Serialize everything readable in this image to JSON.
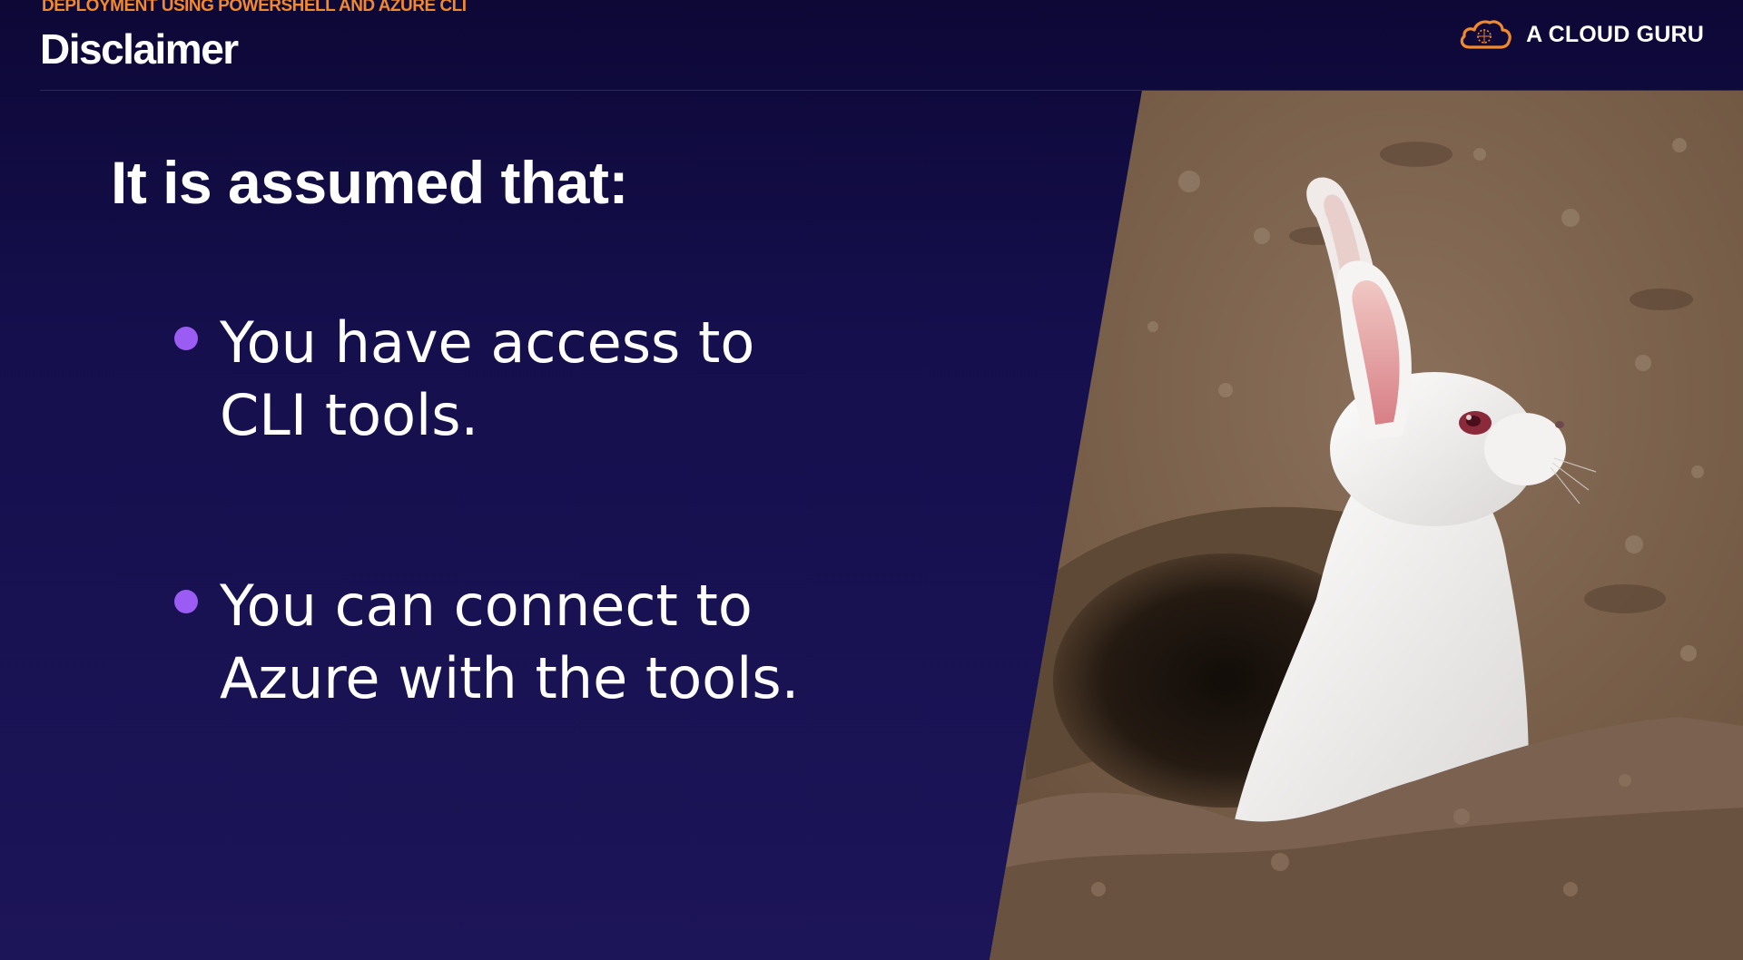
{
  "header": {
    "course": "DEPLOYMENT USING POWERSHELL AND AZURE CLI",
    "title": "Disclaimer",
    "brand": "A CLOUD GURU"
  },
  "content": {
    "lead": "It is assumed that:",
    "bullets": [
      {
        "line1": "You have access to",
        "line2": "CLI tools."
      },
      {
        "line1": "You can connect to",
        "line2": "Azure with the tools."
      }
    ]
  },
  "photo": {
    "subject": "white rabbit emerging from burrow"
  },
  "colors": {
    "background": "#150f4d",
    "accent_orange": "#f28a2c",
    "bullet_purple": "#9b5cf4",
    "text": "#ffffff"
  }
}
